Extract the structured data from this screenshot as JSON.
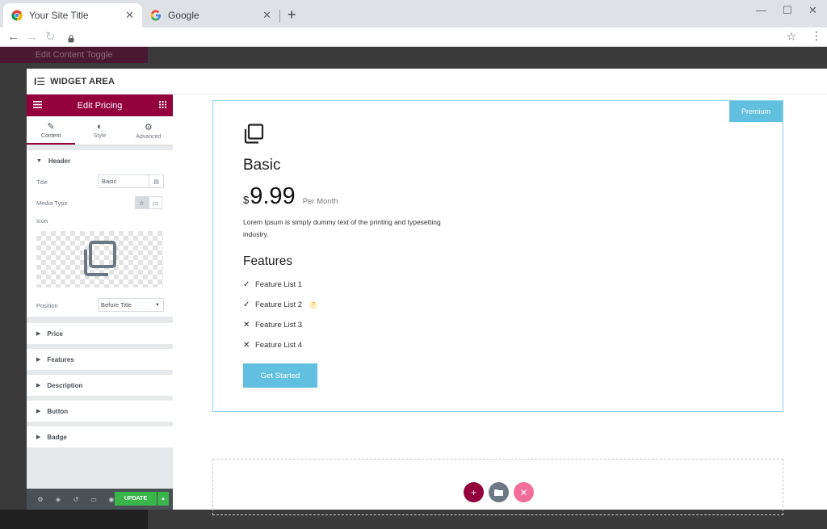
{
  "browser": {
    "tabs": [
      {
        "title": "Your Site Title",
        "close": "✕"
      },
      {
        "title": "Google",
        "close": "✕"
      }
    ],
    "new_tab": "+",
    "window_controls": {
      "minimize": "—",
      "maximize": "☐",
      "close": "✕"
    }
  },
  "background_editor": {
    "header_title": "Edit Content Toggle",
    "footer_label": "UPDATE"
  },
  "widget_area": {
    "title": "WIDGET AREA"
  },
  "panel": {
    "title": "Edit Pricing",
    "tabs": [
      {
        "label": "Content",
        "icon": "pencil-icon"
      },
      {
        "label": "Style",
        "icon": "half-circle-icon"
      },
      {
        "label": "Advanced",
        "icon": "gear-icon"
      }
    ],
    "header_section": {
      "title": "Header",
      "title_label": "Title",
      "title_value": "Basic",
      "media_type_label": "Media Type",
      "icon_label": "Icon",
      "position_label": "Position",
      "position_value": "Before Title"
    },
    "sections": [
      "Price",
      "Features",
      "Description",
      "Button",
      "Badge"
    ],
    "update_label": "UPDATE"
  },
  "card": {
    "badge": "Premium",
    "title": "Basic",
    "currency": "$",
    "price": "9.99",
    "period": "Per Month",
    "description": "Lorem Ipsum is simply dummy text of the printing and typesetting industry.",
    "features_title": "Features",
    "features": [
      {
        "label": "Feature List 1",
        "included": true
      },
      {
        "label": "Feature List 2",
        "included": true,
        "tooltip": "?"
      },
      {
        "label": "Feature List 3",
        "included": false
      },
      {
        "label": "Feature List 4",
        "included": false
      }
    ],
    "button": "Get Started"
  },
  "colors": {
    "panel_header": "#93003c",
    "accent": "#61bfe0",
    "update_green": "#39b54a",
    "dz_add": "#93003c",
    "dz_template": "#6d7882",
    "dz_magic": "#f26d9a"
  }
}
